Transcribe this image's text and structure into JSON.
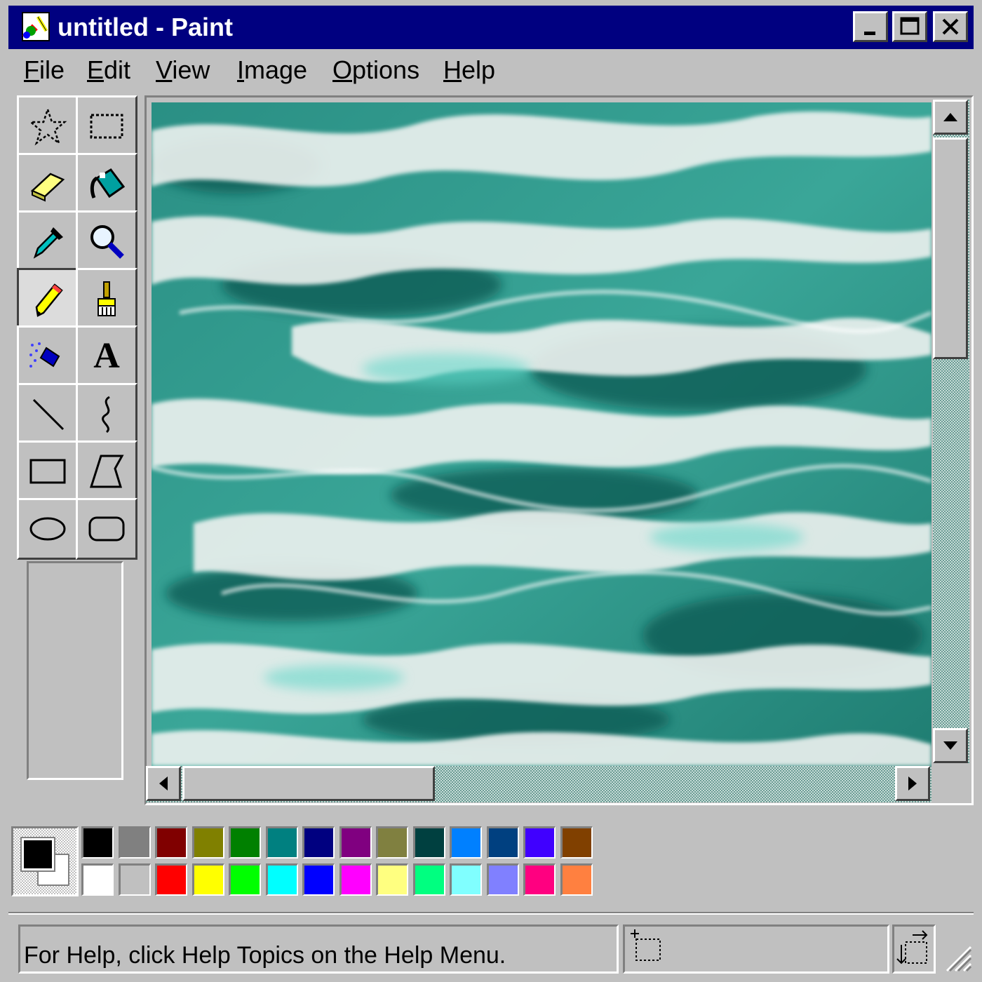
{
  "window": {
    "title": "untitled - Paint",
    "title_bar_color": "#000080",
    "controls": [
      "minimize-icon",
      "maximize-icon",
      "close-icon"
    ]
  },
  "menu": {
    "items": [
      "File",
      "Edit",
      "View",
      "Image",
      "Options",
      "Help"
    ]
  },
  "tools": [
    {
      "name": "free-form-select",
      "icon": "star-select-icon"
    },
    {
      "name": "select",
      "icon": "rect-select-icon"
    },
    {
      "name": "eraser",
      "icon": "eraser-icon"
    },
    {
      "name": "fill-with-color",
      "icon": "paint-bucket-icon"
    },
    {
      "name": "pick-color",
      "icon": "eyedropper-icon"
    },
    {
      "name": "magnifier",
      "icon": "magnifier-icon"
    },
    {
      "name": "pencil",
      "icon": "pencil-icon",
      "selected": true
    },
    {
      "name": "brush",
      "icon": "brush-icon"
    },
    {
      "name": "airbrush",
      "icon": "airbrush-icon"
    },
    {
      "name": "text",
      "icon": "text-icon",
      "glyph": "A"
    },
    {
      "name": "line",
      "icon": "line-icon"
    },
    {
      "name": "curve",
      "icon": "curve-icon"
    },
    {
      "name": "rectangle",
      "icon": "rectangle-icon"
    },
    {
      "name": "polygon",
      "icon": "polygon-icon"
    },
    {
      "name": "ellipse",
      "icon": "ellipse-icon"
    },
    {
      "name": "rounded-rectangle",
      "icon": "rounded-rectangle-icon"
    }
  ],
  "canvas": {
    "content": "water-ripple-image",
    "colors": [
      "#2f9c8e",
      "#1f7d72",
      "#e8ecea",
      "#b8c8c4",
      "#0f4f48"
    ]
  },
  "colors": {
    "foreground": "#000000",
    "background": "#ffffff",
    "palette_top": [
      "#000000",
      "#808080",
      "#800000",
      "#808000",
      "#008000",
      "#008080",
      "#000080",
      "#800080",
      "#808040",
      "#004040",
      "#0080ff",
      "#004080",
      "#4000ff",
      "#804000"
    ],
    "palette_bottom": [
      "#ffffff",
      "#c0c0c0",
      "#ff0000",
      "#ffff00",
      "#00ff00",
      "#00ffff",
      "#0000ff",
      "#ff00ff",
      "#ffff80",
      "#00ff80",
      "#80ffff",
      "#8080ff",
      "#ff0080",
      "#ff8040"
    ]
  },
  "status": {
    "help_text": "For Help, click Help Topics on the Help Menu."
  }
}
